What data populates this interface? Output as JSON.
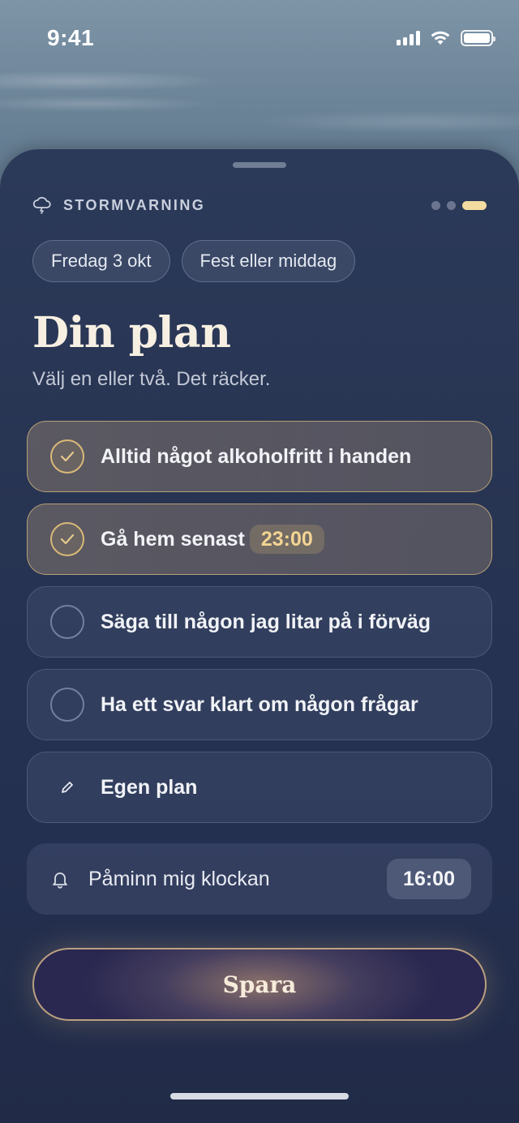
{
  "status_bar": {
    "time": "9:41"
  },
  "header": {
    "label": "STORMVARNING",
    "pager_total": 3,
    "pager_active": 3
  },
  "chips": [
    {
      "label": "Fredag 3 okt"
    },
    {
      "label": "Fest eller middag"
    }
  ],
  "title": "Din plan",
  "subtitle": "Välj en eller två. Det räcker.",
  "options": [
    {
      "label": "Alltid något alkoholfritt i handen",
      "selected": true
    },
    {
      "label": "Gå hem senast",
      "time": "23:00",
      "selected": true
    },
    {
      "label": "Säga till någon jag litar på i förväg",
      "selected": false
    },
    {
      "label": "Ha ett svar klart om någon frågar",
      "selected": false
    }
  ],
  "custom_plan": {
    "label": "Egen plan",
    "icon": "pencil-icon"
  },
  "reminder": {
    "label": "Påminn mig klockan",
    "time": "16:00",
    "icon": "bell-icon"
  },
  "save_button": {
    "label": "Spara"
  },
  "colors": {
    "accent": "#d9b977",
    "sheet": "#283553",
    "title": "#f7efe2"
  }
}
